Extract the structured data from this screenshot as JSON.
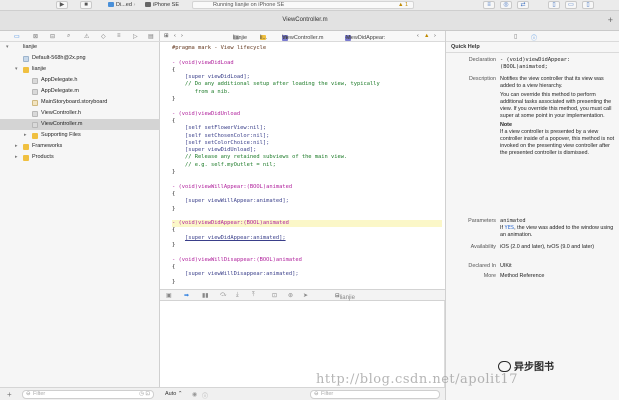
{
  "toolbar": {
    "scheme_target": "Di...ed",
    "scheme_device": "iPhone SE",
    "status_text": "Running lianjie on iPhone SE",
    "warning_count": "1"
  },
  "tab": {
    "title": "ViewController.m"
  },
  "navigator": {
    "items": [
      {
        "label": "lianjie",
        "type": "project",
        "indent": 0,
        "disclosure": "▾",
        "selected": false
      },
      {
        "label": "Default-568h@2x.png",
        "type": "png",
        "indent": 1,
        "disclosure": "",
        "selected": false
      },
      {
        "label": "lianjie",
        "type": "folder",
        "indent": 1,
        "disclosure": "▾",
        "selected": false
      },
      {
        "label": "AppDelegate.h",
        "type": "h",
        "indent": 2,
        "disclosure": "",
        "selected": false
      },
      {
        "label": "AppDelegate.m",
        "type": "m",
        "indent": 2,
        "disclosure": "",
        "selected": false
      },
      {
        "label": "MainStoryboard.storyboard",
        "type": "sb",
        "indent": 2,
        "disclosure": "",
        "selected": false
      },
      {
        "label": "ViewController.h",
        "type": "h",
        "indent": 2,
        "disclosure": "",
        "selected": false
      },
      {
        "label": "ViewController.m",
        "type": "m",
        "indent": 2,
        "disclosure": "",
        "selected": true
      },
      {
        "label": "Supporting Files",
        "type": "folder",
        "indent": 2,
        "disclosure": "▸",
        "selected": false
      },
      {
        "label": "Frameworks",
        "type": "folder",
        "indent": 1,
        "disclosure": "▸",
        "selected": false
      },
      {
        "label": "Products",
        "type": "folder",
        "indent": 1,
        "disclosure": "▸",
        "selected": false
      }
    ],
    "filter_placeholder": "Filter"
  },
  "jumpbar": {
    "project": "lianjie",
    "group": "li...",
    "file": "ViewController.m",
    "method": "-viewDidAppear:",
    "warning_count": "1"
  },
  "code": {
    "pragma": "#pragma mark - View lifecycle",
    "m1_sig": "- (void)viewDidLoad",
    "m1_call": "[super viewDidLoad];",
    "m1_c1": "// Do any additional setup after loading the view, typically",
    "m1_c2": "from a nib.",
    "m2_sig": "- (void)viewDidUnload",
    "m2_l1": "[self setFlowerView:nil];",
    "m2_l2": "[self setChosenColor:nil];",
    "m2_l3": "[self setColorChoice:nil];",
    "m2_l4": "[super viewDidUnload];",
    "m2_c1": "// Release any retained subviews of the main view.",
    "m2_c2": "// e.g. self.myOutlet = nil;",
    "m3_sig": "- (void)viewWillAppear:(BOOL)animated",
    "m3_call": "[super viewWillAppear:animated];",
    "m4_sig": "- (void)viewDidAppear:(BOOL)animated",
    "m4_call": "[super viewDidAppear:animated];",
    "m5_sig": "- (void)viewWillDisappear:(BOOL)animated",
    "m5_call": "[super viewWillDisappear:animated];",
    "open_brace": "{",
    "close_brace": "}"
  },
  "debug_bar": {
    "target": "lianjie"
  },
  "editor_bottom": {
    "auto_label": "Auto ⌃",
    "filter_placeholder": "Filter"
  },
  "quick_help": {
    "title": "Quick Help",
    "declaration_label": "Declaration",
    "declaration": "- (void)viewDidAppear:(BOOL)animated;",
    "description_label": "Description",
    "description_p1": "Notifies the view controller that its view was added to a view hierarchy.",
    "description_p2": "You can override this method to perform additional tasks associated with presenting the view. If you override this method, you must call super at some point in your implementation.",
    "note_label": "Note",
    "note_text": "If a view controller is presented by a view controller inside of a popover, this method is not invoked on the presenting view controller after the presented controller is dismissed.",
    "parameters_label": "Parameters",
    "param_name": "animated",
    "param_desc_pre": "If ",
    "param_desc_kw": "YES",
    "param_desc_post": ", the view was added to the window using an animation.",
    "availability_label": "Availability",
    "availability": "iOS (2.0 and later), tvOS (9.0 and later)",
    "declared_label": "Declared In",
    "declared_in": "UIKit",
    "more_label": "More",
    "more_link": "Method Reference"
  },
  "watermark": {
    "logo_text": "异步图书",
    "url_text": "http://blog.csdn.net/apolit17"
  }
}
